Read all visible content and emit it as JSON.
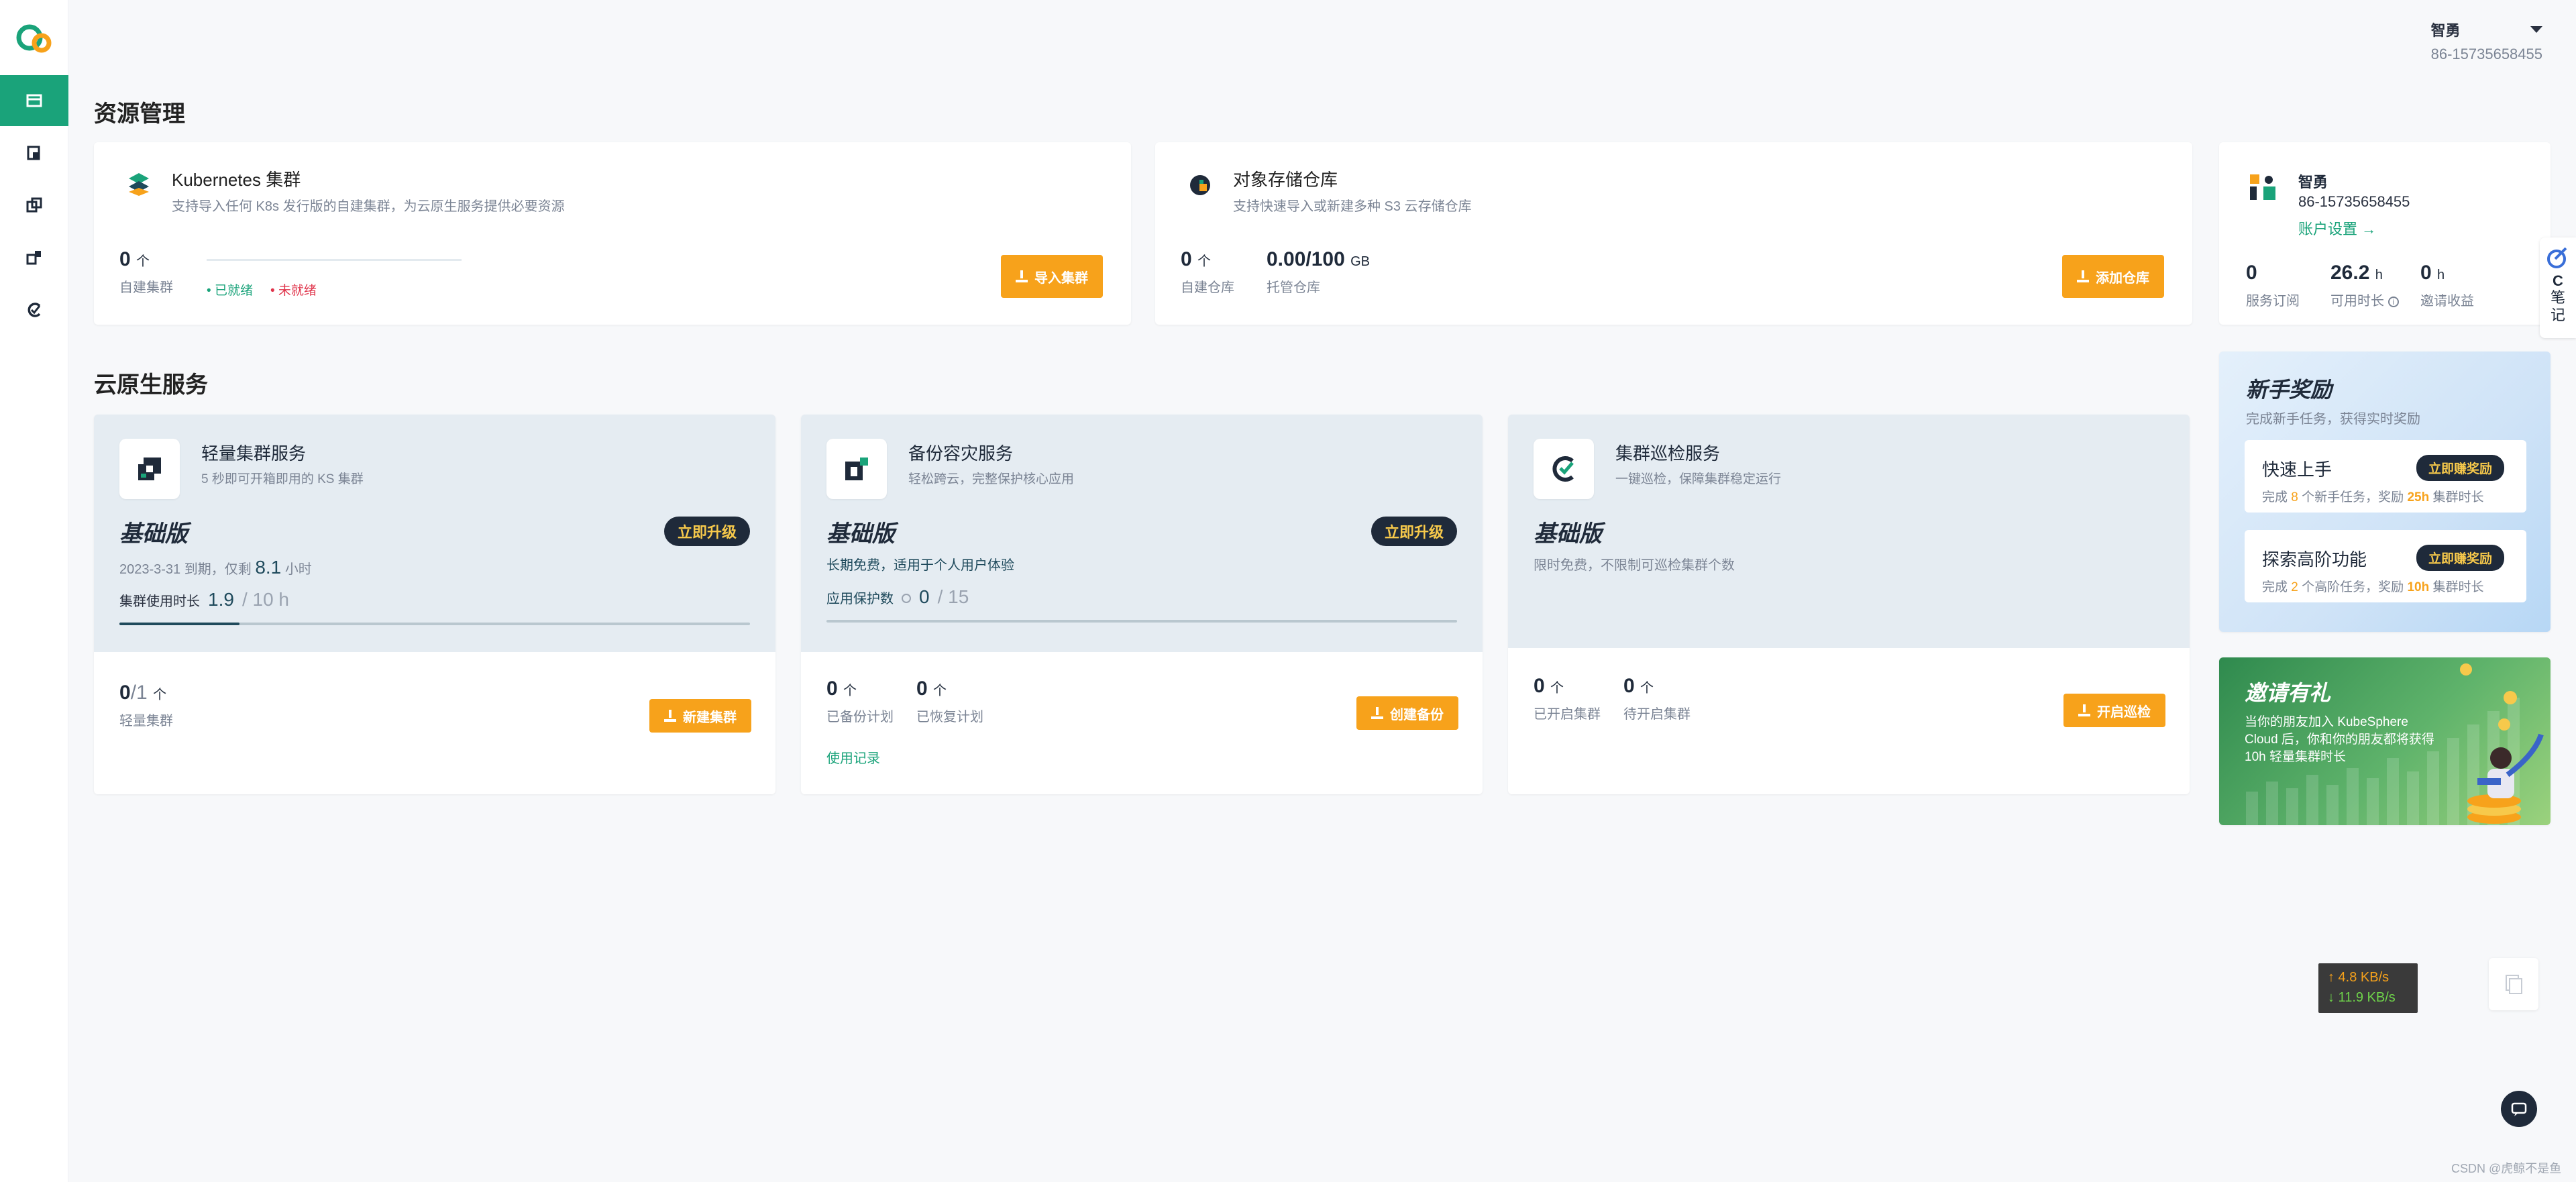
{
  "user": {
    "name": "智勇",
    "phone": "86-15735658455"
  },
  "sections": {
    "resource_title": "资源管理",
    "cloud_title": "云原生服务"
  },
  "k8s_card": {
    "title": "Kubernetes 集群",
    "subtitle": "支持导入任何 K8s 发行版的自建集群，为云原生服务提供必要资源",
    "count": "0",
    "unit": "个",
    "label": "自建集群",
    "legend_ready": "已就绪",
    "legend_not_ready": "未就绪",
    "button": "导入集群"
  },
  "storage_card": {
    "title": "对象存储仓库",
    "subtitle": "支持快速导入或新建多种 S3 云存储仓库",
    "count": "0",
    "unit": "个",
    "label_self": "自建仓库",
    "usage": "0.00/100",
    "usage_unit": "GB",
    "label_managed": "托管仓库",
    "button": "添加仓库"
  },
  "profile_card": {
    "name": "智勇",
    "phone": "86-15735658455",
    "settings": "账户设置 →",
    "stats": [
      {
        "value": "0",
        "unit": "",
        "label": "服务订阅"
      },
      {
        "value": "26.2",
        "unit": "h",
        "label": "可用时长"
      },
      {
        "value": "0",
        "unit": "h",
        "label": "邀请收益"
      }
    ]
  },
  "light_cluster": {
    "title": "轻量集群服务",
    "subtitle": "5 秒即可开箱即用的 KS 集群",
    "edition": "基础版",
    "upgrade": "立即升级",
    "expire_prefix": "2023-3-31 到期，仅剩",
    "expire_value": "8.1",
    "expire_unit": "小时",
    "usage_label": "集群使用时长",
    "usage_value": "1.9",
    "usage_total": "/ 10 h",
    "usage_fraction": 0.19,
    "count": "0",
    "count_suffix": "/1",
    "unit": "个",
    "count_label": "轻量集群",
    "button": "新建集群"
  },
  "backup": {
    "title": "备份容灾服务",
    "subtitle": "轻松跨云，完整保护核心应用",
    "edition": "基础版",
    "upgrade": "立即升级",
    "desc": "长期免费，适用于个人用户体验",
    "protect_label": "应用保护数",
    "protect_value": "0",
    "protect_total": "/ 15",
    "protect_fraction": 0,
    "stats": [
      {
        "value": "0",
        "unit": "个",
        "label": "已备份计划"
      },
      {
        "value": "0",
        "unit": "个",
        "label": "已恢复计划"
      }
    ],
    "link": "使用记录",
    "button": "创建备份"
  },
  "inspection": {
    "title": "集群巡检服务",
    "subtitle": "一键巡检，保障集群稳定运行",
    "edition": "基础版",
    "desc": "限时免费，不限制可巡检集群个数",
    "stats": [
      {
        "value": "0",
        "unit": "个",
        "label": "已开启集群"
      },
      {
        "value": "0",
        "unit": "个",
        "label": "待开启集群"
      }
    ],
    "button": "开启巡检"
  },
  "rewards": {
    "title": "新手奖励",
    "subtitle": "完成新手任务，获得实时奖励",
    "items": [
      {
        "title": "快速上手",
        "button": "立即赚奖励",
        "desc_prefix": "完成",
        "num": "8",
        "desc_mid": "个新手任务，奖励",
        "reward": "25h",
        "desc_suffix": "集群时长"
      },
      {
        "title": "探索高阶功能",
        "button": "立即赚奖励",
        "desc_prefix": "完成",
        "num": "2",
        "desc_mid": "个高阶任务，奖励",
        "reward": "10h",
        "desc_suffix": "集群时长"
      }
    ]
  },
  "invite": {
    "title": "邀请有礼",
    "line1": "当你的朋友加入 KubeSphere",
    "line2": "Cloud 后，你和你的朋友都将获得",
    "line3": "10h 轻量集群时长"
  },
  "speed": {
    "up": "↑ 4.8 KB/s",
    "down": "↓ 11.9 KB/s"
  },
  "note": {
    "c": "C",
    "text": "笔记"
  },
  "watermark": "CSDN @虎鲸不是鱼",
  "colors": {
    "accent": "#1aa37a",
    "orange": "#f7a21b",
    "dark": "#1f2a3a"
  }
}
